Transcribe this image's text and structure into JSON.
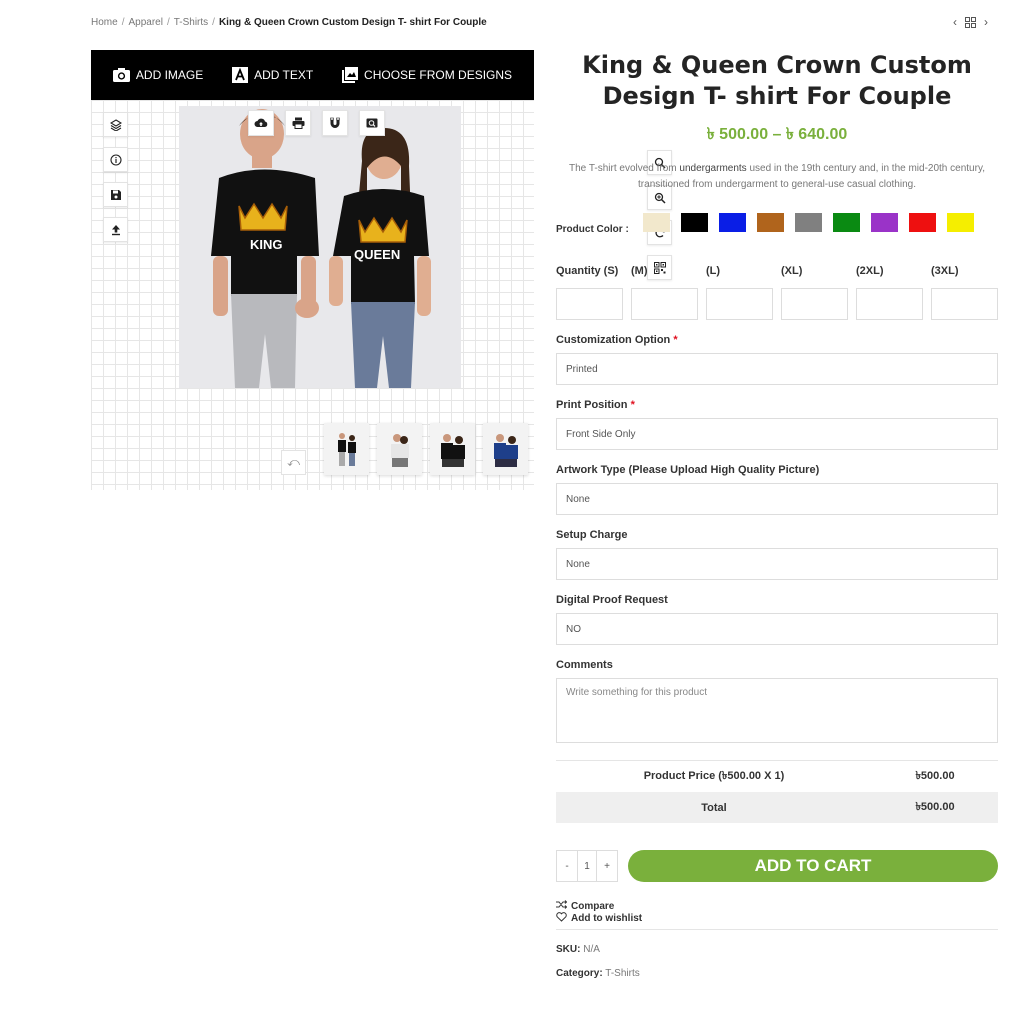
{
  "breadcrumb": {
    "home": "Home",
    "apparel": "Apparel",
    "tshirts": "T-Shirts",
    "current": "King & Queen Crown Custom Design T- shirt For Couple"
  },
  "designer": {
    "add_image": "ADD IMAGE",
    "add_text": "ADD TEXT",
    "choose_designs": "CHOOSE FROM DESIGNS",
    "print_king": "KING",
    "print_queen": "QUEEN"
  },
  "product": {
    "title": "King & Queen Crown Custom Design T- shirt For Couple",
    "price_range": "৳ 500.00 – ৳ 640.00",
    "desc_before": "The T-shirt evolved from ",
    "desc_bold": "undergarments",
    "desc_after": " used in the 19th century and, in the mid-20th century, transitioned from undergarment to general-use casual clothing.",
    "color_label": "Product Color :",
    "colors": [
      "#f2e8cc",
      "#000000",
      "#0a1ee6",
      "#b0641c",
      "#808080",
      "#0a8a12",
      "#9a33c8",
      "#ee1010",
      "#f5ee00"
    ]
  },
  "quantity": {
    "s": "Quantity (S)",
    "m": "(M)",
    "l": "(L)",
    "xl": "(XL)",
    "xxl": "(2XL)",
    "xxxl": "(3XL)"
  },
  "fields": {
    "customization_label": "Customization Option",
    "customization_value": "Printed",
    "position_label": "Print Position",
    "position_value": "Front Side Only",
    "artwork_label": "Artwork Type (Please Upload High Quality Picture)",
    "artwork_value": "None",
    "setup_label": "Setup Charge",
    "setup_value": "None",
    "proof_label": "Digital Proof Request",
    "proof_value": "NO",
    "comments_label": "Comments",
    "comments_placeholder": "Write something for this product",
    "required_mark": "*"
  },
  "totals": {
    "product_price_label": "Product Price (৳500.00 X 1)",
    "product_price_value": "৳500.00",
    "total_label": "Total",
    "total_value": "৳500.00"
  },
  "cart": {
    "minus": "-",
    "qty": "1",
    "plus": "+",
    "add_to_cart": "ADD TO CART"
  },
  "links": {
    "compare": "Compare",
    "wishlist": "Add to wishlist"
  },
  "meta": {
    "sku_label": "SKU:",
    "sku_value": "N/A",
    "category_label": "Category:",
    "category_value": "T-Shirts"
  }
}
